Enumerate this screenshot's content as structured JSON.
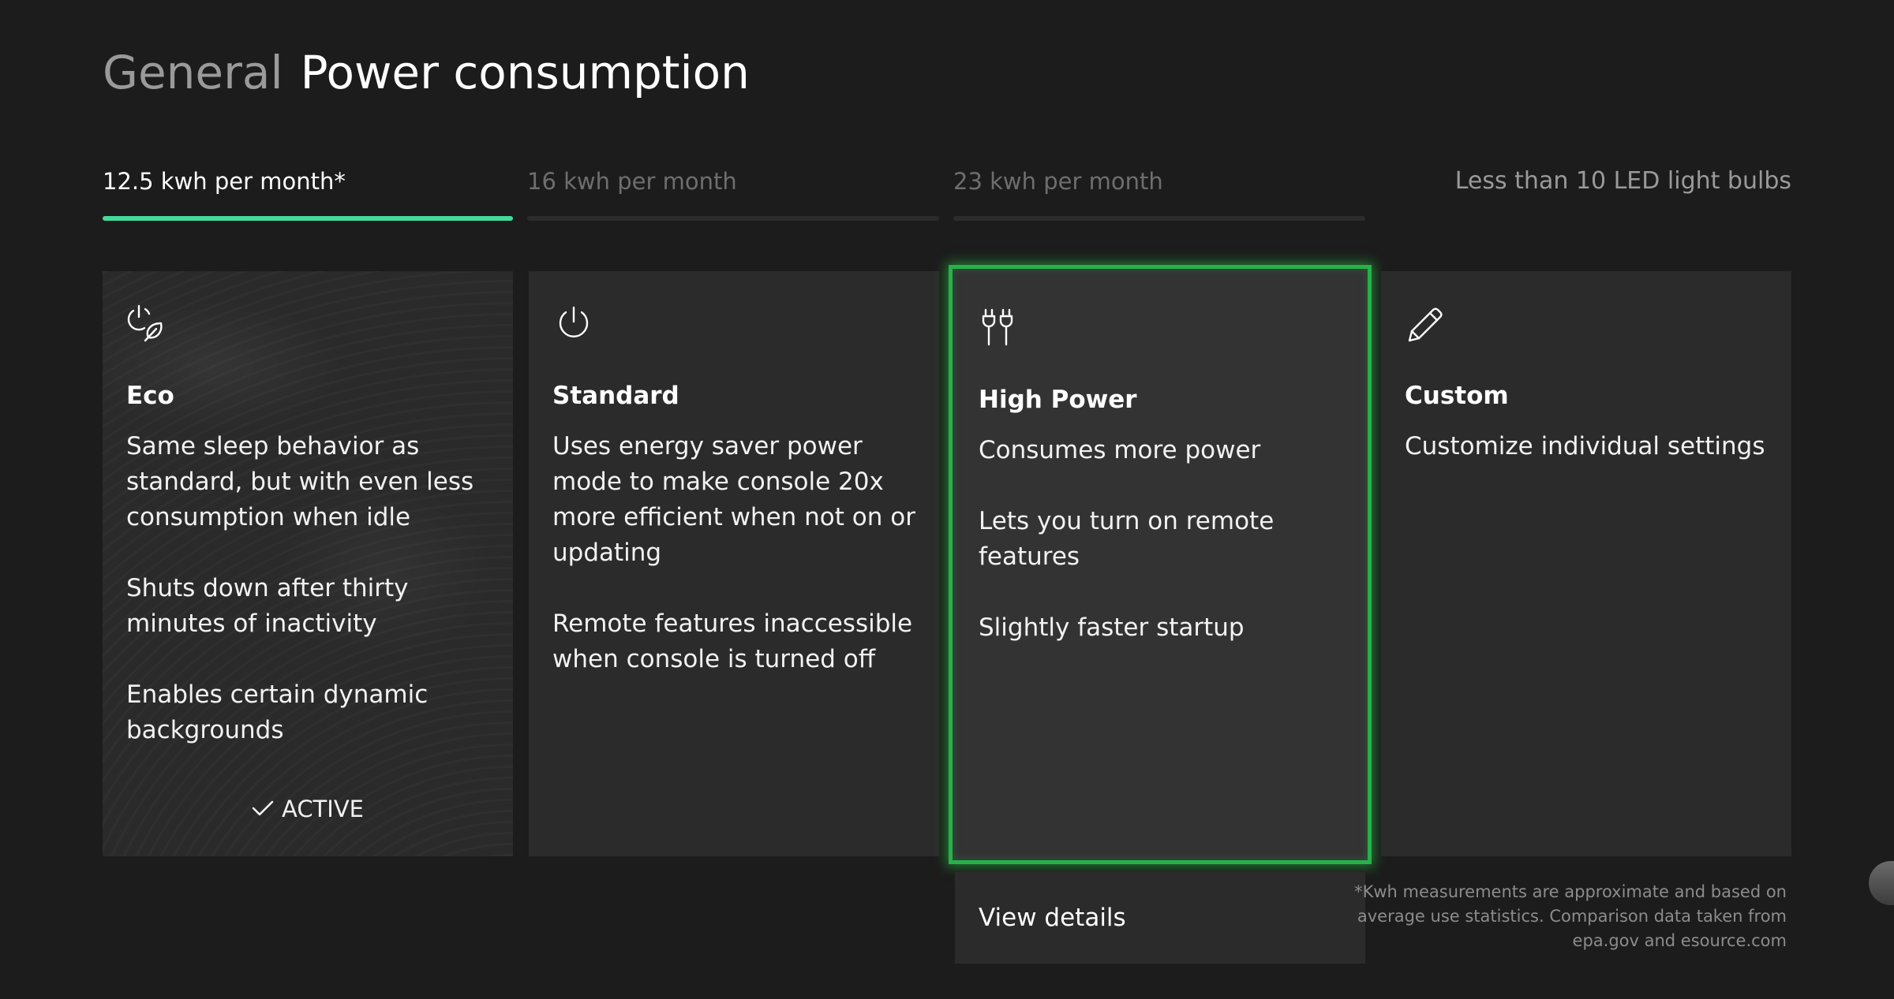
{
  "header": {
    "section": "General",
    "title": "Power consumption"
  },
  "tabs": [
    {
      "label": "12.5 kwh per month*",
      "active": true
    },
    {
      "label": "16 kwh per month",
      "active": false
    },
    {
      "label": "23 kwh per month",
      "active": false
    }
  ],
  "comparison": "Less than 10 LED light bulbs",
  "cards": [
    {
      "icon": "power-leaf-icon",
      "title": "Eco",
      "lines": [
        "Same sleep behavior as standard, but with even less consumption when idle",
        "Shuts down after thirty minutes of inactivity",
        "Enables certain dynamic backgrounds"
      ],
      "status": "ACTIVE"
    },
    {
      "icon": "power-icon",
      "title": "Standard",
      "lines": [
        "Uses energy saver power mode to make console 20x more efficient when not on or updating",
        "Remote features inaccessible when console is turned off"
      ]
    },
    {
      "icon": "plug-icon",
      "title": "High Power",
      "lines": [
        "Consumes more power",
        "Lets you turn on remote features",
        "Slightly faster startup"
      ]
    },
    {
      "icon": "pencil-icon",
      "title": "Custom",
      "lines": [
        "Customize individual settings"
      ]
    }
  ],
  "view_details": "View details",
  "footnote": "*Kwh measurements are approximate and based on average use statistics. Comparison data taken from epa.gov and esource.com",
  "colors": {
    "accent": "#45d99b",
    "selection": "#27b14a",
    "background": "#1c1c1c",
    "card": "#2b2b2b"
  }
}
